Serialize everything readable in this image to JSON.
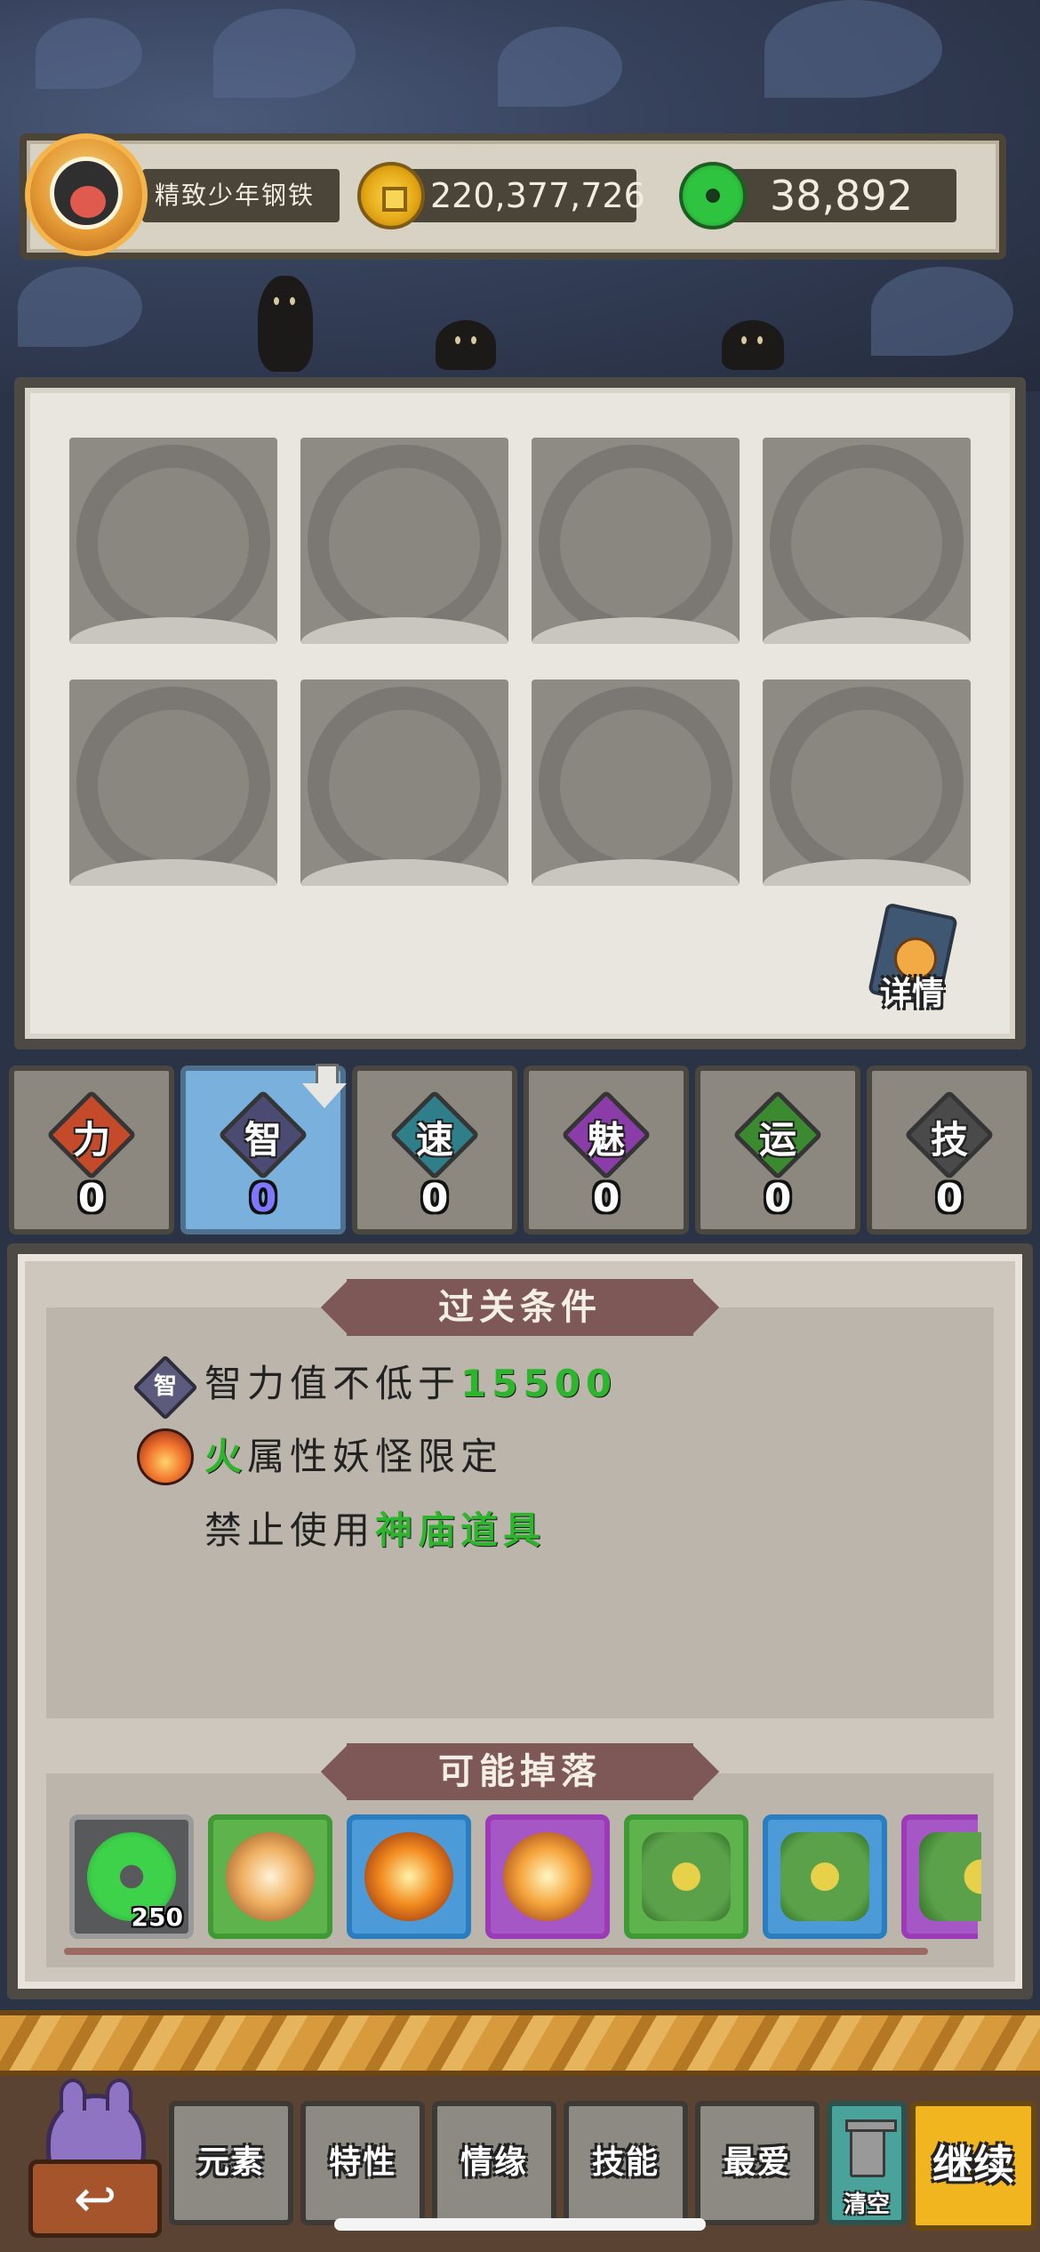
{
  "player": {
    "name": "精致少年钢铁",
    "coins": "220,377,726",
    "jade": "38,892"
  },
  "details_label": "详情",
  "attributes": [
    {
      "label": "力",
      "value": "0",
      "color": "#c44a2a"
    },
    {
      "label": "智",
      "value": "0",
      "color": "#4b4a73"
    },
    {
      "label": "速",
      "value": "0",
      "color": "#2f7f8a"
    },
    {
      "label": "魅",
      "value": "0",
      "color": "#8a3da8"
    },
    {
      "label": "运",
      "value": "0",
      "color": "#3b8a30"
    },
    {
      "label": "技",
      "value": "0",
      "color": "#4a4a4a"
    }
  ],
  "selected_attribute": "智",
  "conditions": {
    "title": "过关条件",
    "row1_badge": "智",
    "row1_text": "智力值不低于",
    "row1_value": "15500",
    "row2_element": "火",
    "row2_text": "属性妖怪限定",
    "row3_text": "禁止使用",
    "row3_item": "神庙道具"
  },
  "drops": {
    "title": "可能掉落",
    "items": [
      {
        "icon": "jade-ring-icon",
        "count": "250",
        "border": "#9a9a9a"
      },
      {
        "icon": "wind-orb-icon",
        "count": "",
        "border": "#3f9a35"
      },
      {
        "icon": "fire-orb-icon",
        "count": "",
        "border": "#2a7ec0"
      },
      {
        "icon": "fire-orb-icon",
        "count": "",
        "border": "#9b3bb7"
      },
      {
        "icon": "clover-gem-icon",
        "count": "",
        "border": "#3f9a35"
      },
      {
        "icon": "clover-gem-icon",
        "count": "",
        "border": "#2a7ec0"
      },
      {
        "icon": "clover-gem-icon",
        "count": "",
        "border": "#9b3bb7"
      }
    ]
  },
  "menu": {
    "elements": "元素",
    "traits": "特性",
    "bonds": "情缘",
    "skills": "技能",
    "favorites": "最爱",
    "clear": "清空",
    "continue": "继续"
  }
}
